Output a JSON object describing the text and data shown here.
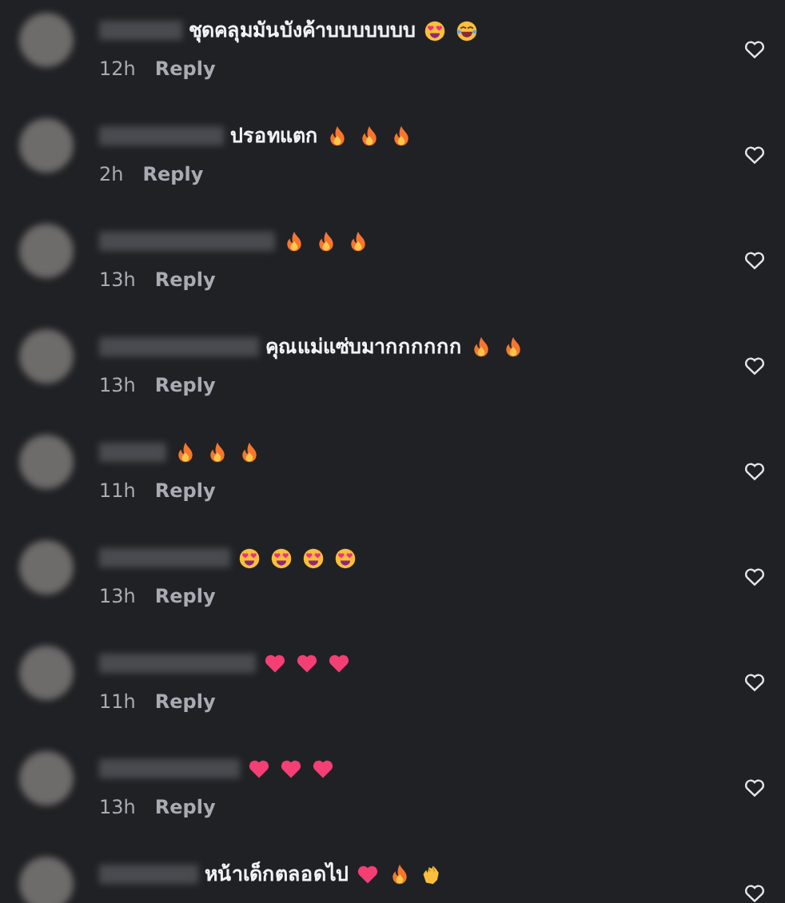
{
  "comments": [
    {
      "text": "ชุดคลุมมันบังค้าบบบบบบบ",
      "emoji": [
        {
          "kind": "heart-eyes"
        },
        {
          "kind": "laughing"
        }
      ],
      "time": "12h",
      "reply": "Reply",
      "liked": false
    },
    {
      "text": "ปรอทแตก",
      "emoji": [
        {
          "kind": "fire"
        },
        {
          "kind": "fire"
        },
        {
          "kind": "fire"
        }
      ],
      "time": "2h",
      "reply": "Reply",
      "liked": false
    },
    {
      "emoji": [
        {
          "kind": "fire"
        },
        {
          "kind": "fire"
        },
        {
          "kind": "fire"
        }
      ],
      "time": "13h",
      "reply": "Reply",
      "liked": false
    },
    {
      "text": "คุณแม่แซ่บมากกกกกก",
      "emoji": [
        {
          "kind": "fire"
        },
        {
          "kind": "fire"
        }
      ],
      "time": "13h",
      "reply": "Reply",
      "liked": false
    },
    {
      "emoji": [
        {
          "kind": "fire"
        },
        {
          "kind": "fire"
        },
        {
          "kind": "fire"
        }
      ],
      "time": "11h",
      "reply": "Reply",
      "liked": false
    },
    {
      "emoji": [
        {
          "kind": "heart-eyes"
        },
        {
          "kind": "heart-eyes"
        },
        {
          "kind": "heart-eyes"
        },
        {
          "kind": "heart-eyes"
        }
      ],
      "time": "13h",
      "reply": "Reply",
      "liked": false
    },
    {
      "emoji": [
        {
          "kind": "heart"
        },
        {
          "kind": "heart"
        },
        {
          "kind": "heart"
        }
      ],
      "time": "11h",
      "reply": "Reply",
      "liked": false
    },
    {
      "emoji": [
        {
          "kind": "heart"
        },
        {
          "kind": "heart"
        },
        {
          "kind": "heart"
        }
      ],
      "time": "13h",
      "reply": "Reply",
      "liked": false
    },
    {
      "text": "หน้าเด็กตลอดไป",
      "emoji": [
        {
          "kind": "heart"
        },
        {
          "kind": "fire"
        },
        {
          "kind": "clap"
        }
      ],
      "liked": false
    }
  ]
}
